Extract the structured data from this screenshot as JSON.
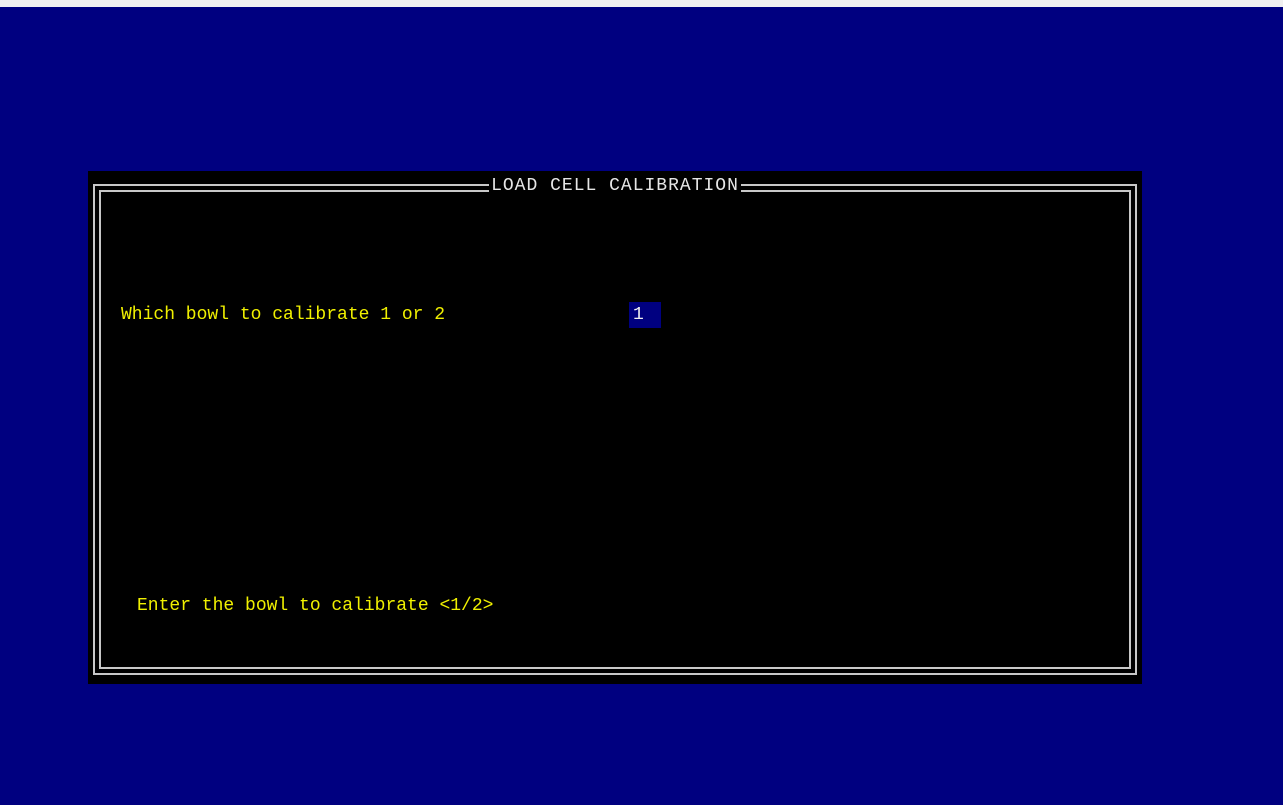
{
  "dialog": {
    "title": "LOAD CELL CALIBRATION",
    "prompt": "Which bowl to calibrate 1 or 2",
    "input_value": "1",
    "help_text": "Enter the bowl to calibrate <1/2>"
  },
  "colors": {
    "background": "#000080",
    "dialog_background": "#000000",
    "prompt_text": "#f0f000",
    "frame": "#c8c8c8",
    "input_background": "#000080"
  }
}
